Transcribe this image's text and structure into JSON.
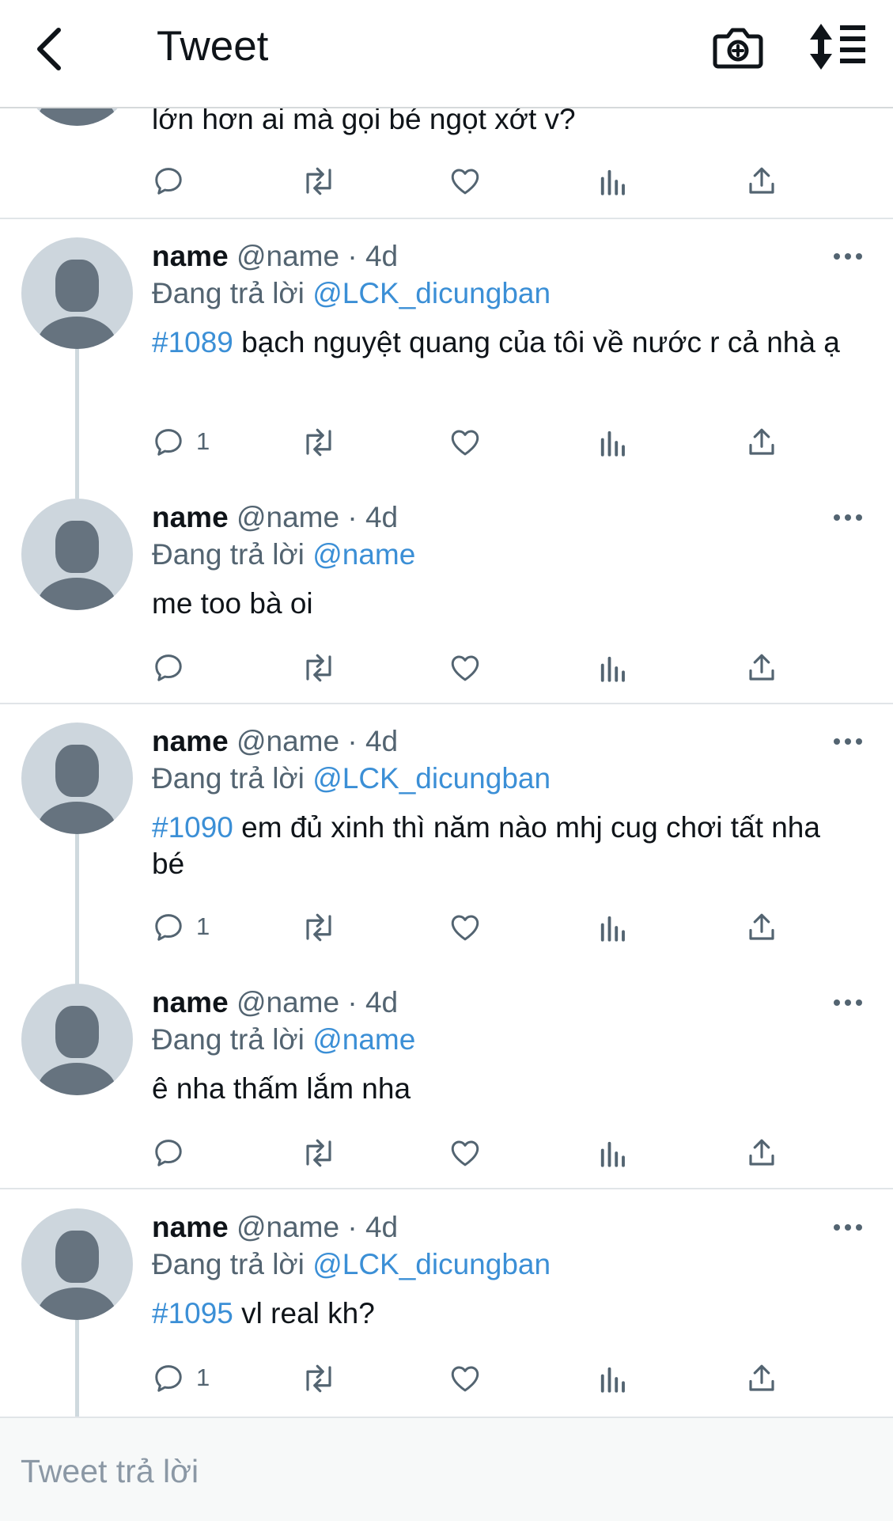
{
  "header": {
    "title": "Tweet",
    "icons": [
      "back-arrow-icon",
      "camera-add-icon",
      "sort-icon"
    ]
  },
  "partial_tweet": {
    "text": "lớn hơn ai mà gọi bé ngọt xớt v?"
  },
  "tweets": [
    {
      "name": "name",
      "handle": "@name",
      "dot": "·",
      "time": "4d",
      "replying_label": "Đang trả lời",
      "replying_to": "@LCK_dicungban",
      "hashtag": "#1089",
      "text": " bạch nguyệt quang của tôi về nước r cả nhà ạ",
      "reply_count": "1"
    },
    {
      "name": "name",
      "handle": "@name",
      "dot": "·",
      "time": "4d",
      "replying_label": "Đang trả lời",
      "replying_to": "@name",
      "hashtag": "",
      "text": "me too bà oi",
      "reply_count": ""
    },
    {
      "name": "name",
      "handle": "@name",
      "dot": "·",
      "time": "4d",
      "replying_label": "Đang trả lời",
      "replying_to": "@LCK_dicungban",
      "hashtag": "#1090",
      "text": " em đủ xinh thì năm nào mhj cug chơi tất nha bé",
      "reply_count": "1"
    },
    {
      "name": "name",
      "handle": "@name",
      "dot": "·",
      "time": "4d",
      "replying_label": "Đang trả lời",
      "replying_to": "@name",
      "hashtag": "",
      "text": "ê nha thấm lắm nha",
      "reply_count": ""
    },
    {
      "name": "name",
      "handle": "@name",
      "dot": "·",
      "time": "4d",
      "replying_label": "Đang trả lời",
      "replying_to": "@LCK_dicungban",
      "hashtag": "#1095",
      "text": " vl real kh?",
      "reply_count": "1"
    }
  ],
  "action_icons": [
    "reply-icon",
    "retweet-icon",
    "like-icon",
    "analytics-icon",
    "share-icon"
  ],
  "composer": {
    "placeholder": "Tweet trả lời"
  },
  "colors": {
    "link": "#3b8fd6",
    "muted": "#536471",
    "avatar_bg": "#cdd6dd",
    "avatar_fg": "#66737f"
  }
}
